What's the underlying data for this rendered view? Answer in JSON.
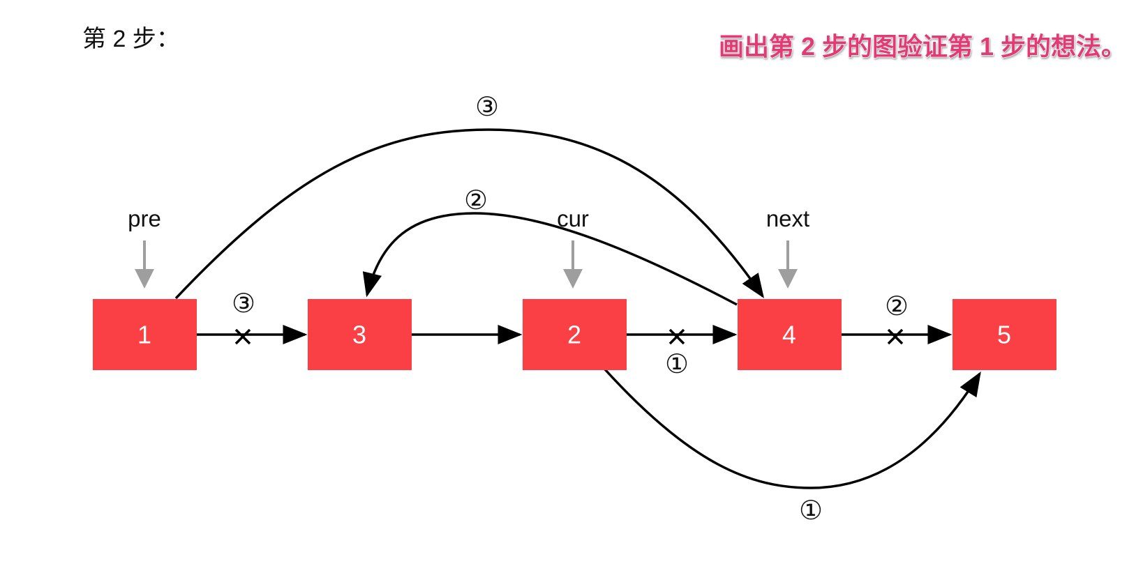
{
  "title": "第 2 步：",
  "hint": "画出第 2 步的图验证第 1 步的想法。",
  "colors": {
    "node_fill": "#fb4045",
    "node_text": "#ffffff",
    "hint_text": "#e23a73",
    "pointer_arrow": "#9e9e9e",
    "edge": "#000000"
  },
  "nodes": [
    {
      "id": "n1",
      "label": "1"
    },
    {
      "id": "n3",
      "label": "3"
    },
    {
      "id": "n2",
      "label": "2"
    },
    {
      "id": "n4",
      "label": "4"
    },
    {
      "id": "n5",
      "label": "5"
    }
  ],
  "pointers": [
    {
      "label": "pre",
      "target": "n1"
    },
    {
      "label": "cur",
      "target": "n2"
    },
    {
      "label": "next",
      "target": "n4"
    }
  ],
  "edges": [
    {
      "from": "n1",
      "to": "n3",
      "crossed": true,
      "step": "③"
    },
    {
      "from": "n3",
      "to": "n2",
      "crossed": false,
      "step": ""
    },
    {
      "from": "n2",
      "to": "n4",
      "crossed": true,
      "step": "①"
    },
    {
      "from": "n4",
      "to": "n5",
      "crossed": true,
      "step": "②"
    },
    {
      "from": "n1",
      "to": "n4",
      "crossed": false,
      "step": "③"
    },
    {
      "from": "n4",
      "to": "n3",
      "crossed": false,
      "step": "②"
    },
    {
      "from": "n2",
      "to": "n5",
      "crossed": false,
      "step": "①"
    }
  ]
}
